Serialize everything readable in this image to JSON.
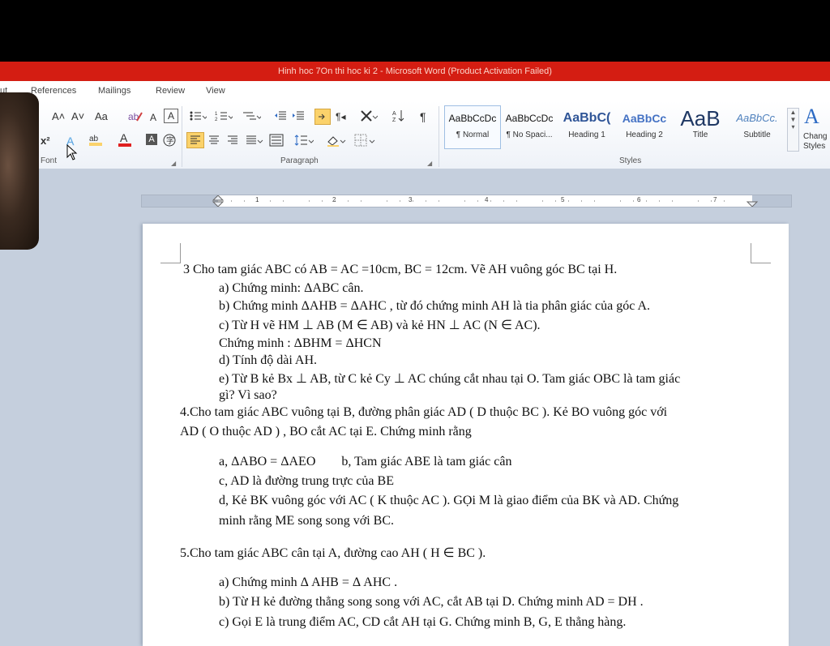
{
  "window": {
    "title": "Hinh hoc 7On thi hoc ki 2  -  Microsoft Word (Product Activation Failed)"
  },
  "tabs": [
    "ut",
    "References",
    "Mailings",
    "Review",
    "View"
  ],
  "ribbon": {
    "font_group_label": "Font",
    "paragraph_group_label": "Paragraph",
    "styles_group_label": "Styles",
    "font_buttons": {
      "grow": "A˄",
      "shrink": "A˅",
      "change_case": "Aa",
      "superscript": "x²",
      "highlight": "ab",
      "font_color": "A"
    },
    "styles": [
      {
        "sample": "AaBbCcDc",
        "name": "¶ Normal"
      },
      {
        "sample": "AaBbCcDc",
        "name": "¶ No Spaci..."
      },
      {
        "sample": "AaBbC(",
        "name": "Heading 1"
      },
      {
        "sample": "AaBbCc",
        "name": "Heading 2"
      },
      {
        "sample": "AaB",
        "name": "Title"
      },
      {
        "sample": "AaBbCc.",
        "name": "Subtitle"
      }
    ],
    "change_styles": {
      "icon_text": "A",
      "label_line1": "Chang",
      "label_line2": "Styles"
    }
  },
  "ruler": {
    "numbers": [
      "1",
      "2",
      "3",
      "4",
      "5",
      "6",
      "7"
    ]
  },
  "document": {
    "lines": [
      "3 Cho tam giác ABC có AB = AC =10cm, BC = 12cm. Vẽ AH vuông góc BC tại H.",
      "a) Chứng minh: ΔABC  cân.",
      "b) Chứng minh  ΔAHB = ΔAHC , từ đó chứng minh AH là tia phân giác của góc A.",
      "c) Từ H vẽ HM ⊥ AB (M ∈ AB) và kẻ HN ⊥ AC (N ∈ AC).",
      "Chứng minh :  ΔBHM = ΔHCN",
      "d) Tính độ dài AH.",
      "e) Từ B kẻ Bx ⊥ AB, từ C kẻ Cy ⊥  AC chúng cắt nhau tại O. Tam giác OBC là tam giác",
      "gì? Vì sao?",
      "4.Cho tam giác ABC vuông tại B, đường phân giác AD ( D thuộc BC ). Kẻ BO vuông góc với",
      "AD ( O thuộc AD ) , BO cắt AC tại E. Chứng minh rằng",
      "a, ΔABO = ΔAEO        b, Tam giác ABE là tam giác cân",
      "c, AD là đường trung trực của BE",
      "d, Kẻ BK vuông  góc với AC ( K thuộc AC ). GỌi M là giao điểm của BK và AD. Chứng",
      "minh rằng ME song song với BC.",
      "5.Cho tam giác ABC cân tại A, đường cao AH ( H ∈ BC ).",
      "a) Chứng minh Δ AHB = Δ AHC .",
      "b) Từ H kẻ đường thẳng song song với AC, cắt AB tại D. Chứng minh AD = DH  .",
      "c) Gọi E là trung điểm AC, CD cắt AH tại G. Chứng minh B, G, E thẳng hàng."
    ]
  },
  "colors": {
    "titlebar": "#d41d12",
    "workspace": "#c5cfdd",
    "highlight_button": "#fbd26b"
  }
}
